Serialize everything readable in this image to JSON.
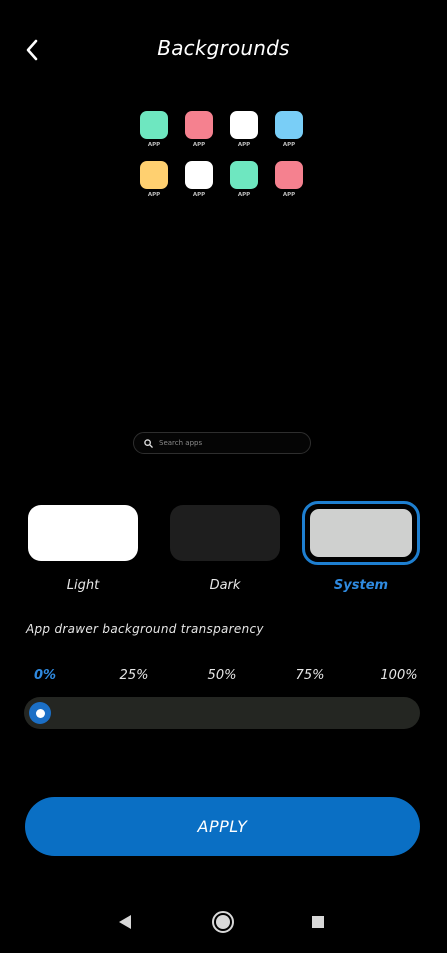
{
  "header": {
    "title": "Backgrounds",
    "back_icon": "chevron-left-icon"
  },
  "preview": {
    "apps": [
      {
        "label": "APP",
        "color": "#6ee7c0"
      },
      {
        "label": "APP",
        "color": "#f5818f"
      },
      {
        "label": "APP",
        "color": "#ffffff"
      },
      {
        "label": "APP",
        "color": "#79cef7"
      },
      {
        "label": "APP",
        "color": "#ffd070"
      },
      {
        "label": "APP",
        "color": "#ffffff"
      },
      {
        "label": "APP",
        "color": "#6ee7c0"
      },
      {
        "label": "APP",
        "color": "#f5818f"
      }
    ],
    "search_placeholder": "Search apps"
  },
  "background_options": [
    {
      "label": "Light",
      "color": "#ffffff",
      "selected": false
    },
    {
      "label": "Dark",
      "color": "#1e1e1e",
      "selected": false
    },
    {
      "label": "System",
      "color": "#cfd0cf",
      "selected": true
    }
  ],
  "transparency": {
    "label": "App drawer background transparency",
    "ticks": [
      "0%",
      "25%",
      "50%",
      "75%",
      "100%"
    ],
    "selected_tick": "0%",
    "value_percent": 0
  },
  "apply_label": "APPLY",
  "colors": {
    "accent": "#1e7fd0",
    "apply_button": "#0a6fc4",
    "slider_track": "#242622"
  }
}
